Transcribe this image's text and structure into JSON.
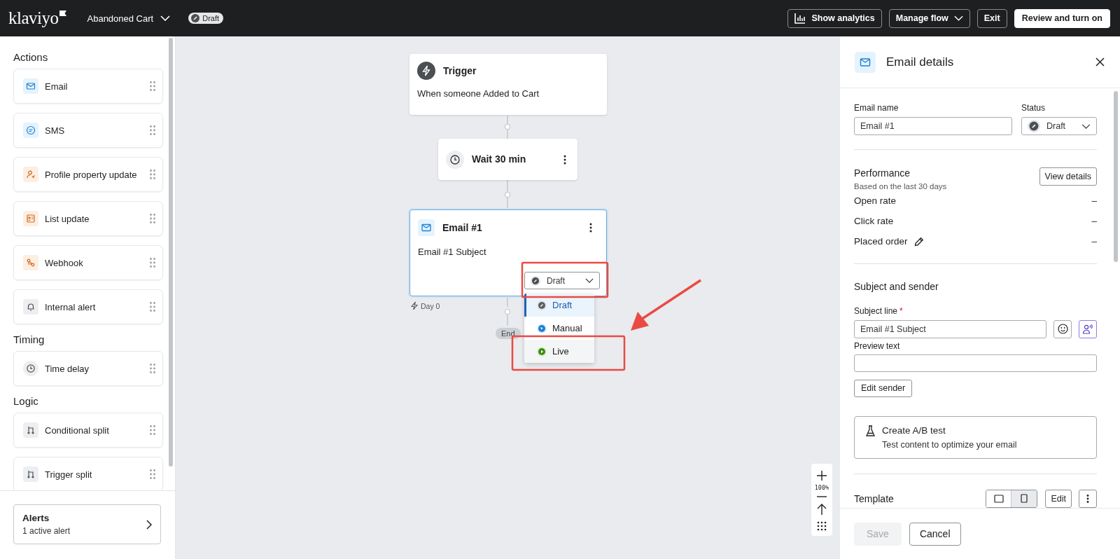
{
  "topbar": {
    "logo": "klaviyo",
    "flow_name": "Abandoned Cart",
    "status_badge": "Draft",
    "buttons": [
      {
        "label": "Show analytics",
        "kind": "analytics"
      },
      {
        "label": "Manage flow",
        "kind": "menu"
      },
      {
        "label": "Exit",
        "kind": "plain"
      },
      {
        "label": "Review and turn on",
        "kind": "primary"
      }
    ]
  },
  "sidebar": {
    "sections": [
      {
        "title": "Actions",
        "items": [
          {
            "label": "Email",
            "kind": "email"
          },
          {
            "label": "SMS",
            "kind": "sms"
          },
          {
            "label": "Profile property update",
            "kind": "profile"
          },
          {
            "label": "List update",
            "kind": "list"
          },
          {
            "label": "Webhook",
            "kind": "webhook"
          },
          {
            "label": "Internal alert",
            "kind": "alert"
          }
        ]
      },
      {
        "title": "Timing",
        "items": [
          {
            "label": "Time delay",
            "kind": "delay"
          }
        ]
      },
      {
        "title": "Logic",
        "items": [
          {
            "label": "Conditional split",
            "kind": "split"
          },
          {
            "label": "Trigger split",
            "kind": "split"
          }
        ]
      }
    ],
    "alerts": {
      "title": "Alerts",
      "subtitle": "1 active alert"
    }
  },
  "canvas": {
    "trigger": {
      "title": "Trigger",
      "description": "When someone Added to Cart"
    },
    "wait": {
      "title": "Wait 30 min"
    },
    "email_node": {
      "title": "Email #1",
      "subject": "Email #1 Subject",
      "status": "Draft",
      "selected": true
    },
    "status_menu": [
      {
        "label": "Draft",
        "kind": "draft",
        "selected": true
      },
      {
        "label": "Manual",
        "kind": "manual",
        "selected": false
      },
      {
        "label": "Live",
        "kind": "live",
        "selected": false
      }
    ],
    "day_label": "Day 0",
    "end_label": "End",
    "zoom": "100%"
  },
  "panel": {
    "title": "Email details",
    "email_name": {
      "label": "Email name",
      "value": "Email #1"
    },
    "status": {
      "label": "Status",
      "value": "Draft"
    },
    "performance": {
      "title": "Performance",
      "subtitle": "Based on the last 30 days",
      "button": "View details",
      "metrics": [
        {
          "label": "Open rate",
          "value": "–",
          "editable": false
        },
        {
          "label": "Click rate",
          "value": "–",
          "editable": false
        },
        {
          "label": "Placed order",
          "value": "–",
          "editable": true
        }
      ]
    },
    "subject_sender": {
      "title": "Subject and sender",
      "subject_label": "Subject line",
      "required_mark": "*",
      "subject_value": "Email #1 Subject",
      "preview_label": "Preview text",
      "edit_button": "Edit sender"
    },
    "ab_test": {
      "title": "Create A/B test",
      "description": "Test content to optimize your email"
    },
    "template": {
      "title": "Template",
      "preview_modes": [
        {
          "kind": "desktop",
          "selected": false
        },
        {
          "kind": "mobile",
          "selected": true
        }
      ],
      "edit_button": "Edit"
    },
    "footer": [
      {
        "label": "Save",
        "disabled": true
      },
      {
        "label": "Cancel",
        "disabled": false
      }
    ]
  }
}
